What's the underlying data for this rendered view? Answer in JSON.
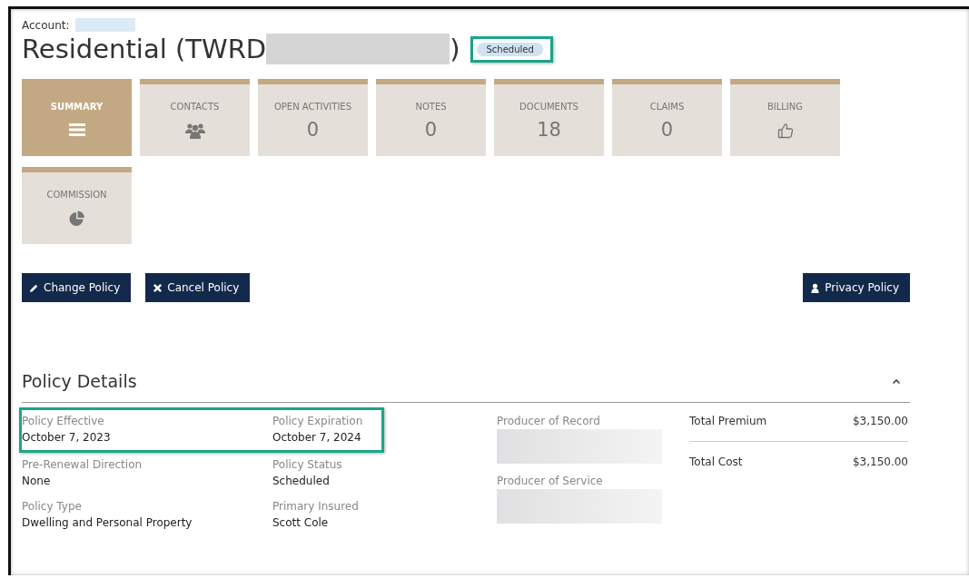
{
  "account_label": "Account:",
  "title": {
    "text": "Residential (TWRD",
    "close": ")"
  },
  "status_badge": {
    "text": "Scheduled",
    "highlighted": true
  },
  "tiles": [
    {
      "label": "SUMMARY",
      "kind": "icon",
      "selected": true
    },
    {
      "label": "CONTACTS",
      "kind": "icon",
      "selected": false
    },
    {
      "label": "OPEN ACTIVITIES",
      "kind": "count",
      "value": "0",
      "selected": false
    },
    {
      "label": "NOTES",
      "kind": "count",
      "value": "0",
      "selected": false
    },
    {
      "label": "DOCUMENTS",
      "kind": "count",
      "value": "18",
      "selected": false
    },
    {
      "label": "CLAIMS",
      "kind": "count",
      "value": "0",
      "selected": false
    },
    {
      "label": "BILLING",
      "kind": "icon",
      "selected": false
    },
    {
      "label": "COMMISSION",
      "kind": "icon",
      "selected": false
    }
  ],
  "actions": [
    {
      "label": "Change Policy"
    },
    {
      "label": "Cancel Policy"
    },
    {
      "label": "Privacy Policy"
    }
  ],
  "section": {
    "title": "Policy Details",
    "expanded": true
  },
  "details": [
    {
      "label": "Policy Effective",
      "value": "October 7, 2023",
      "highlighted": true
    },
    {
      "label": "Policy Expiration",
      "value": "October 7, 2024",
      "highlighted": true
    },
    {
      "label": "Pre-Renewal Direction",
      "value": "None",
      "highlighted": false
    },
    {
      "label": "Policy Status",
      "value": "Scheduled",
      "highlighted": false
    },
    {
      "label": "Policy Type",
      "value": "Dwelling and Personal Property",
      "highlighted": false
    },
    {
      "label": "Primary Insured",
      "value": "Scott Cole",
      "highlighted": false
    }
  ],
  "producers": [
    {
      "label": "Producer of Record"
    },
    {
      "label": "Producer of Service"
    }
  ],
  "totals": [
    {
      "label": "Total Premium",
      "value": "$3,150.00"
    },
    {
      "label": "Total Cost",
      "value": "$3,150.00"
    }
  ]
}
